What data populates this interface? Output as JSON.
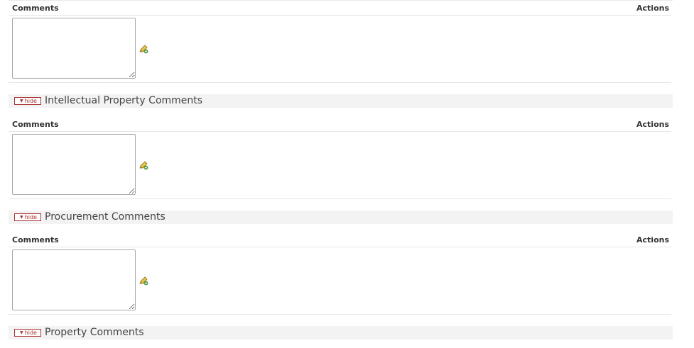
{
  "table_headers": {
    "comments": "Comments",
    "actions": "Actions"
  },
  "blocks": [
    {
      "comment_value": ""
    },
    {
      "comment_value": ""
    },
    {
      "comment_value": ""
    }
  ],
  "sections": [
    {
      "hide_label": "hide",
      "title": "Intellectual Property Comments"
    },
    {
      "hide_label": "hide",
      "title": "Procurement Comments"
    },
    {
      "hide_label": "hide",
      "title": "Property Comments"
    }
  ],
  "icons": {
    "edit": "pencil-edit-icon",
    "hide_arrow": "triangle-down-icon"
  },
  "colors": {
    "section_bar": "#f3f3f3",
    "hide_button_border": "#aa3333",
    "hide_button_text": "#b03030",
    "divider": "#e6e6e6"
  }
}
